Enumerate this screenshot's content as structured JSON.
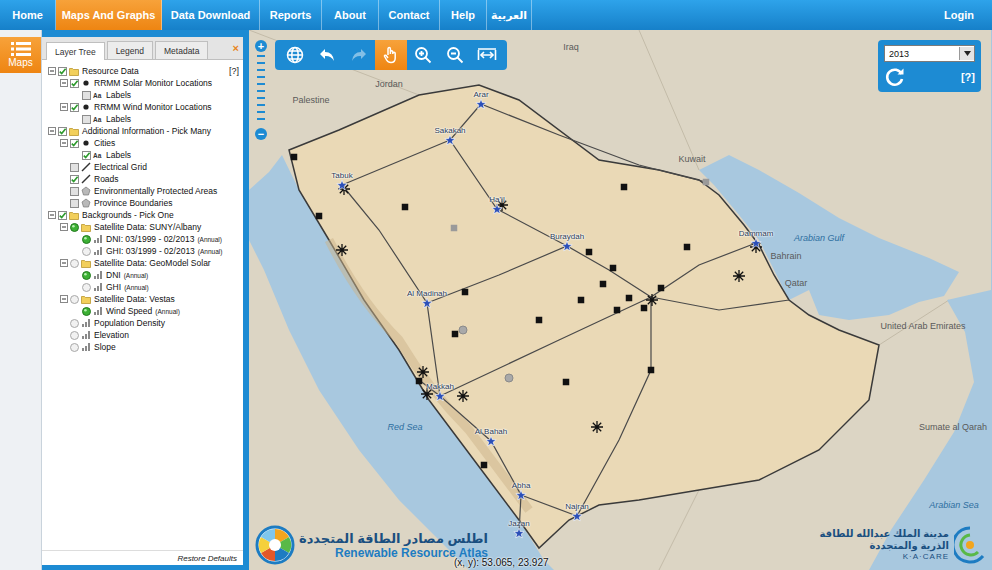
{
  "nav": {
    "items": [
      {
        "label": "Home",
        "selected": false
      },
      {
        "label": "Maps And Graphs",
        "selected": true
      },
      {
        "label": "Data Download",
        "selected": false
      },
      {
        "label": "Reports",
        "selected": false
      },
      {
        "label": "About",
        "selected": false
      },
      {
        "label": "Contact",
        "selected": false
      },
      {
        "label": "Help",
        "selected": false
      },
      {
        "label": "العربية",
        "selected": false
      }
    ],
    "login": "Login"
  },
  "sidebar": {
    "button": {
      "label": "Maps",
      "selected": true
    }
  },
  "layer_panel": {
    "tabs": [
      {
        "label": "Layer Tree",
        "selected": true
      },
      {
        "label": "Legend",
        "selected": false
      },
      {
        "label": "Metadata",
        "selected": false
      }
    ],
    "close": "×",
    "rows": [
      {
        "kind": "check",
        "depth": 0,
        "icon": "folder",
        "label": "Resource Data",
        "checked": true,
        "expanded": true,
        "help": "[?]"
      },
      {
        "kind": "check",
        "depth": 1,
        "icon": "dot",
        "label": "RRMM Solar Monitor Locations",
        "checked": true,
        "expanded": true
      },
      {
        "kind": "check",
        "depth": 2,
        "icon": "text",
        "badge": "Aa",
        "label": "Labels",
        "checked": false
      },
      {
        "kind": "check",
        "depth": 1,
        "icon": "dot",
        "label": "RRMM Wind Monitor Locations",
        "checked": true,
        "expanded": true
      },
      {
        "kind": "check",
        "depth": 2,
        "icon": "text",
        "badge": "Aa",
        "label": "Labels",
        "checked": false
      },
      {
        "kind": "check",
        "depth": 0,
        "icon": "folder",
        "label": "Additional Information - Pick Many",
        "checked": true,
        "expanded": true
      },
      {
        "kind": "check",
        "depth": 1,
        "icon": "dot",
        "label": "Cities",
        "checked": true,
        "expanded": true
      },
      {
        "kind": "check",
        "depth": 2,
        "icon": "text",
        "badge": "Aa",
        "label": "Labels",
        "checked": true
      },
      {
        "kind": "check",
        "depth": 1,
        "icon": "line",
        "label": "Electrical Grid",
        "checked": false
      },
      {
        "kind": "check",
        "depth": 1,
        "icon": "line",
        "label": "Roads",
        "checked": true
      },
      {
        "kind": "check",
        "depth": 1,
        "icon": "polygon",
        "label": "Environmentally Protected Areas",
        "checked": false
      },
      {
        "kind": "check",
        "depth": 1,
        "icon": "polygon",
        "label": "Province Boundaries",
        "checked": false
      },
      {
        "kind": "check",
        "depth": 0,
        "icon": "folder",
        "label": "Backgrounds - Pick One",
        "checked": true,
        "expanded": true
      },
      {
        "kind": "radio",
        "depth": 1,
        "icon": "folder",
        "label": "Satellite Data: SUNY/Albany",
        "selected": true,
        "expanded": true
      },
      {
        "kind": "radio",
        "depth": 2,
        "icon": "bars",
        "label": "DNI: 03/1999 - 02/2013",
        "suffix": "(Annual)",
        "selected": true
      },
      {
        "kind": "radio",
        "depth": 2,
        "icon": "bars",
        "label": "GHI: 03/1999 - 02/2013",
        "suffix": "(Annual)",
        "selected": false
      },
      {
        "kind": "radio",
        "depth": 1,
        "icon": "folder",
        "label": "Satellite Data: GeoModel Solar",
        "selected": false,
        "expanded": true
      },
      {
        "kind": "radio",
        "depth": 2,
        "icon": "bars",
        "label": "DNI",
        "suffix": "(Annual)",
        "selected": true
      },
      {
        "kind": "radio",
        "depth": 2,
        "icon": "bars",
        "label": "GHI",
        "suffix": "(Annual)",
        "selected": false
      },
      {
        "kind": "radio",
        "depth": 1,
        "icon": "folder",
        "label": "Satellite Data: Vestas",
        "selected": false,
        "expanded": true
      },
      {
        "kind": "radio",
        "depth": 2,
        "icon": "bars",
        "label": "Wind Speed",
        "suffix": "(Annual)",
        "selected": true
      },
      {
        "kind": "radio",
        "depth": 1,
        "icon": "bars",
        "label": "Population Density",
        "selected": false
      },
      {
        "kind": "radio",
        "depth": 1,
        "icon": "bars",
        "label": "Elevation",
        "selected": false
      },
      {
        "kind": "radio",
        "depth": 1,
        "icon": "bars",
        "label": "Slope",
        "selected": false
      }
    ],
    "footer": "Restore Defaults"
  },
  "map_tools": {
    "tools": [
      {
        "kind": "globe",
        "selected": false,
        "disabled": false
      },
      {
        "kind": "back",
        "selected": false,
        "disabled": false
      },
      {
        "kind": "forward",
        "selected": false,
        "disabled": true
      },
      {
        "kind": "pan",
        "selected": true,
        "disabled": false
      },
      {
        "kind": "zoomin",
        "selected": false,
        "disabled": false
      },
      {
        "kind": "zoomout",
        "selected": false,
        "disabled": false
      },
      {
        "kind": "extent",
        "selected": false,
        "disabled": false
      }
    ]
  },
  "zoom": {
    "in": "+",
    "out": "−"
  },
  "year": {
    "value": "2013",
    "help": "[?]"
  },
  "map": {
    "labels": [
      {
        "label": "Iraq",
        "kind": "country"
      },
      {
        "label": "Jordan",
        "kind": "country"
      },
      {
        "label": "Palestine",
        "kind": "country"
      },
      {
        "label": "Kuwait",
        "kind": "country"
      },
      {
        "label": "Arabian Gulf",
        "kind": "sea"
      },
      {
        "label": "Bahrain",
        "kind": "country"
      },
      {
        "label": "Qatar",
        "kind": "country"
      },
      {
        "label": "United Arab Emirates",
        "kind": "country"
      },
      {
        "label": "Red Sea",
        "kind": "sea"
      },
      {
        "label": "Sumate al Qarah",
        "kind": "country"
      },
      {
        "label": "Arabian Sea",
        "kind": "sea"
      }
    ],
    "cities": [
      {
        "label": "Arar"
      },
      {
        "label": "Sakakah"
      },
      {
        "label": "Tabuk"
      },
      {
        "label": "Ha'il"
      },
      {
        "label": "Buraydah"
      },
      {
        "label": "Dammam"
      },
      {
        "label": "Al Madinah"
      },
      {
        "label": "Makkah"
      },
      {
        "label": "Al Bahah"
      },
      {
        "label": "Abha"
      },
      {
        "label": "Jazan"
      },
      {
        "label": "Najran"
      }
    ],
    "coords": "(x, y): 53.065, 23.927"
  },
  "branding": {
    "atlas_ar": "اطلس مصادر الطاقة المتجددة",
    "atlas_en": "Renewable Resource Atlas",
    "kacare_ar_1": "مدينة الملك عبدالله للطاقة",
    "kacare_ar_2": "الذرية والمتجددة",
    "kacare_en": "K·A·CARE"
  }
}
